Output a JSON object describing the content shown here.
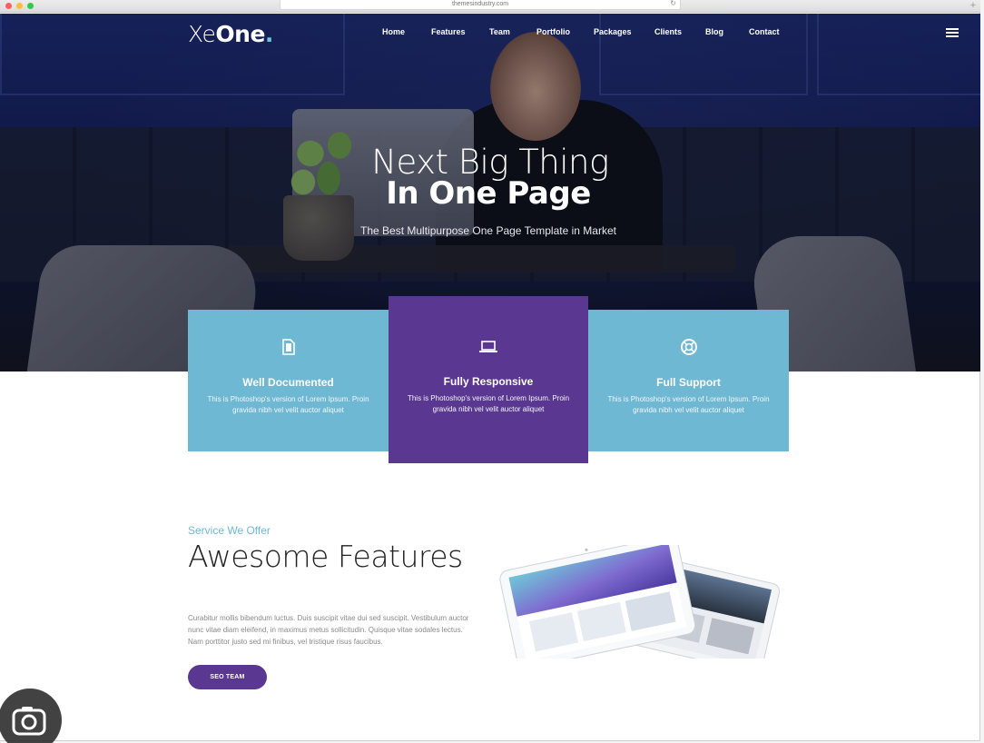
{
  "browser": {
    "url": "themesindustry.com"
  },
  "header": {
    "logo_light": "Xe",
    "logo_bold": "One",
    "logo_dot": ".",
    "nav": [
      "Home",
      "Features",
      "Team",
      "Portfolio",
      "Packages",
      "Clients",
      "Blog",
      "Contact"
    ]
  },
  "hero": {
    "title_light": "Next Big Thing",
    "title_bold": "In One Page",
    "subtitle": "The Best Multipurpose One Page Template in Market"
  },
  "cards": [
    {
      "icon": "document-icon",
      "title": "Well Documented",
      "text": "This is Photoshop's version of Lorem Ipsum. Proin gravida nibh vel velit auctor aliquet",
      "color": "#6fb8d3"
    },
    {
      "icon": "laptop-icon",
      "title": "Fully Responsive",
      "text": "This is Photoshop's version of Lorem Ipsum. Proin gravida nibh vel velit auctor aliquet",
      "color": "#5a3791"
    },
    {
      "icon": "lifebuoy-icon",
      "title": "Full Support",
      "text": "This is Photoshop's version of Lorem Ipsum. Proin gravida nibh vel velit auctor aliquet",
      "color": "#6fb8d3"
    }
  ],
  "features": {
    "kicker": "Service We Offer",
    "title": "Awesome Features",
    "body": "Curabitur mollis bibendum luctus. Duis suscipit vitae dui sed suscipit. Vestibulum auctor nunc vitae diam eleifend, in maximus metus sollicitudin. Quisque vitae sodales lectus. Nam porttitor justo sed mi finibus, vel tristique risus faucibus.",
    "button": "SEO TEAM"
  },
  "colors": {
    "accent_blue": "#6fb8d3",
    "accent_purple": "#5a3791"
  }
}
